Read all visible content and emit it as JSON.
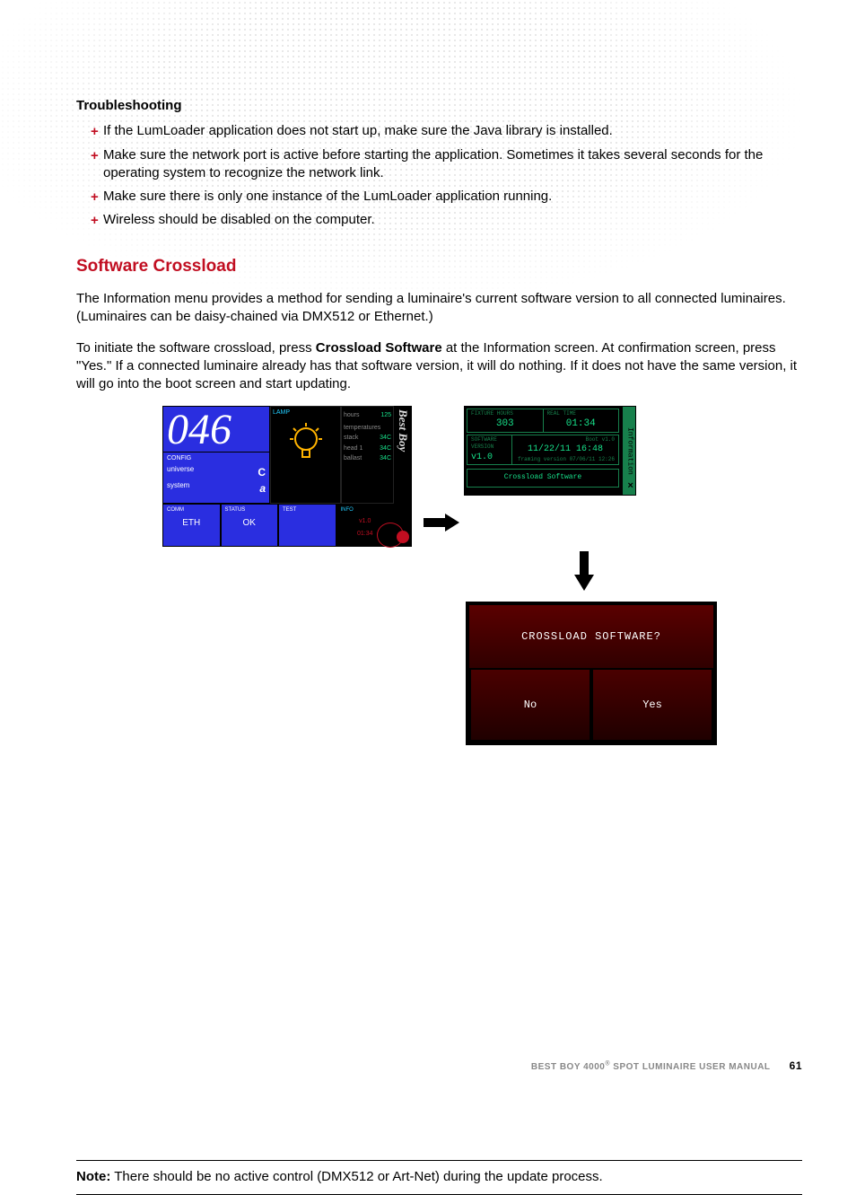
{
  "troubleshooting": {
    "heading": "Troubleshooting",
    "items": [
      "If the LumLoader application does not start up, make sure the Java library is installed.",
      "Make sure the network port is active before starting the application. Sometimes it takes several seconds for the operating system to recognize the network link.",
      "Make sure there is only one instance of the LumLoader application running.",
      "Wireless should be disabled on the computer."
    ]
  },
  "section": {
    "heading": "Software Crossload",
    "p1": "The Information menu provides a method for sending a luminaire's current software version to all connected luminaires. (Luminaires can be daisy-chained via DMX512 or Ethernet.)",
    "p2a": "To initiate the software crossload, press ",
    "p2b": "Crossload Software",
    "p2c": " at the Information screen. At confirmation screen, press \"Yes.\" If a connected luminaire already has that software version, it will do nothing. If it does not have the same version, it will go into the boot screen and start updating."
  },
  "screen1": {
    "addr": "046",
    "config_label": "CONFIG",
    "universe_label": "universe",
    "universe_val": "C",
    "system_label": "system",
    "system_val": "a",
    "lamp_label": "LAMP",
    "hours_label": "hours",
    "hours_val": "125",
    "temps_label": "temperatures",
    "stack_label": "stack",
    "stack_val": "34C",
    "head_label": "head 1",
    "head_val": "34C",
    "ballast_label": "ballast",
    "ballast_val": "34C",
    "brand": "Best Boy",
    "comm_label": "COMM",
    "comm_val": "ETH",
    "status_label": "STATUS",
    "status_val": "OK",
    "test_label": "TEST",
    "info_label": "INFO",
    "info_v1": "v1.0",
    "info_v2": "01:34"
  },
  "screen2": {
    "fixture_hours_label": "FIXTURE HOURS",
    "fixture_hours_val": "303",
    "time_label": "REAL TIME",
    "time_val": "01:34",
    "sw_label": "SOFTWARE VERSION",
    "sw_val": "v1.0",
    "date_val": "11/22/11 16:48",
    "boot_label": "Boot v1.0",
    "sub": "framing version 07/06/11 12:26",
    "btn": "Crossload Software",
    "side": "Information",
    "close": "×"
  },
  "screen3": {
    "title": "CROSSLOAD SOFTWARE?",
    "no": "No",
    "yes": "Yes"
  },
  "note": {
    "label": "Note:",
    "text": "  There should be no active control (DMX512 or Art-Net) during the update process."
  },
  "footer": {
    "a": "BEST BOY 4000",
    "b": " SPOT LUMINAIRE USER MANUAL",
    "page": "61",
    "reg": "®"
  }
}
